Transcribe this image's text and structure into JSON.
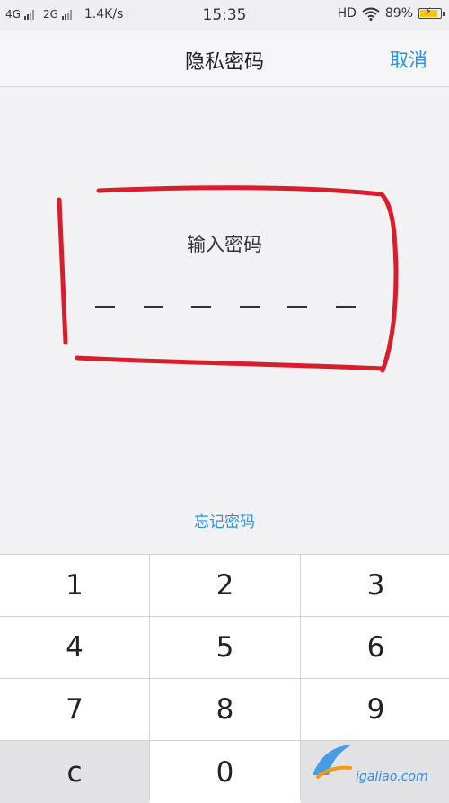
{
  "status_bar": {
    "net1": "4G",
    "net2": "2G",
    "speed": "1.4K/s",
    "time": "15:35",
    "hd": "HD",
    "battery": "89%"
  },
  "header": {
    "title": "隐私密码",
    "cancel_label": "取消"
  },
  "password": {
    "prompt": "输入密码",
    "length": 6,
    "slots": [
      "",
      "",
      "",
      "",
      "",
      ""
    ]
  },
  "forgot_label": "忘记密码",
  "keypad": {
    "keys": [
      "1",
      "2",
      "3",
      "4",
      "5",
      "6",
      "7",
      "8",
      "9",
      "c",
      "0",
      ""
    ]
  },
  "watermark": {
    "text": "igaliao.com"
  },
  "colors": {
    "accent": "#2a90e5",
    "annotation": "#d81e2c",
    "background": "#f2f2f4"
  }
}
